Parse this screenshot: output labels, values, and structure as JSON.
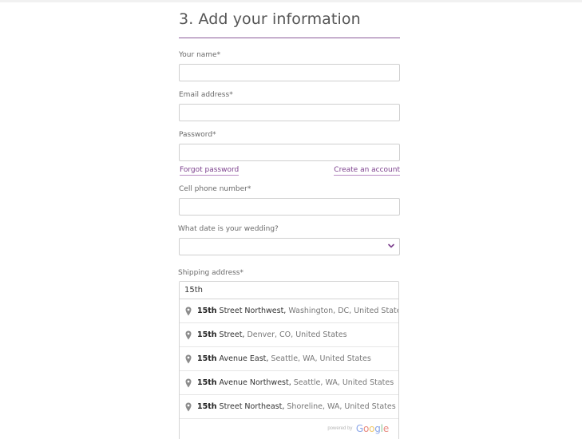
{
  "section": {
    "title": "3. Add your information"
  },
  "fields": {
    "name": {
      "label": "Your name*",
      "value": ""
    },
    "email": {
      "label": "Email address*",
      "value": ""
    },
    "password": {
      "label": "Password*",
      "value": ""
    },
    "phone": {
      "label": "Cell phone number*",
      "value": ""
    },
    "wedding_date": {
      "label": "What date is your wedding?",
      "selected": ""
    },
    "shipping": {
      "label": "Shipping address*",
      "value": "15th"
    }
  },
  "links": {
    "forgot_password": "Forgot password",
    "create_account": "Create an account"
  },
  "autocomplete": {
    "items": [
      {
        "match": "15th",
        "main": " Street Northwest,",
        "secondary": " Washington, DC, United States"
      },
      {
        "match": "15th",
        "main": " Street,",
        "secondary": " Denver, CO, United States"
      },
      {
        "match": "15th",
        "main": " Avenue East,",
        "secondary": " Seattle, WA, United States"
      },
      {
        "match": "15th",
        "main": " Avenue Northwest,",
        "secondary": " Seattle, WA, United States"
      },
      {
        "match": "15th",
        "main": " Street Northeast,",
        "secondary": " Shoreline, WA, United States"
      }
    ],
    "powered_by": "powered by",
    "google": [
      "G",
      "o",
      "o",
      "g",
      "l",
      "e"
    ]
  },
  "icons": {
    "pin": "map-pin-icon",
    "chevron": "chevron-down-icon"
  },
  "colors": {
    "accent": "#7b3f8c",
    "rule": "#8a5a9a",
    "border": "#cfcfcf"
  }
}
